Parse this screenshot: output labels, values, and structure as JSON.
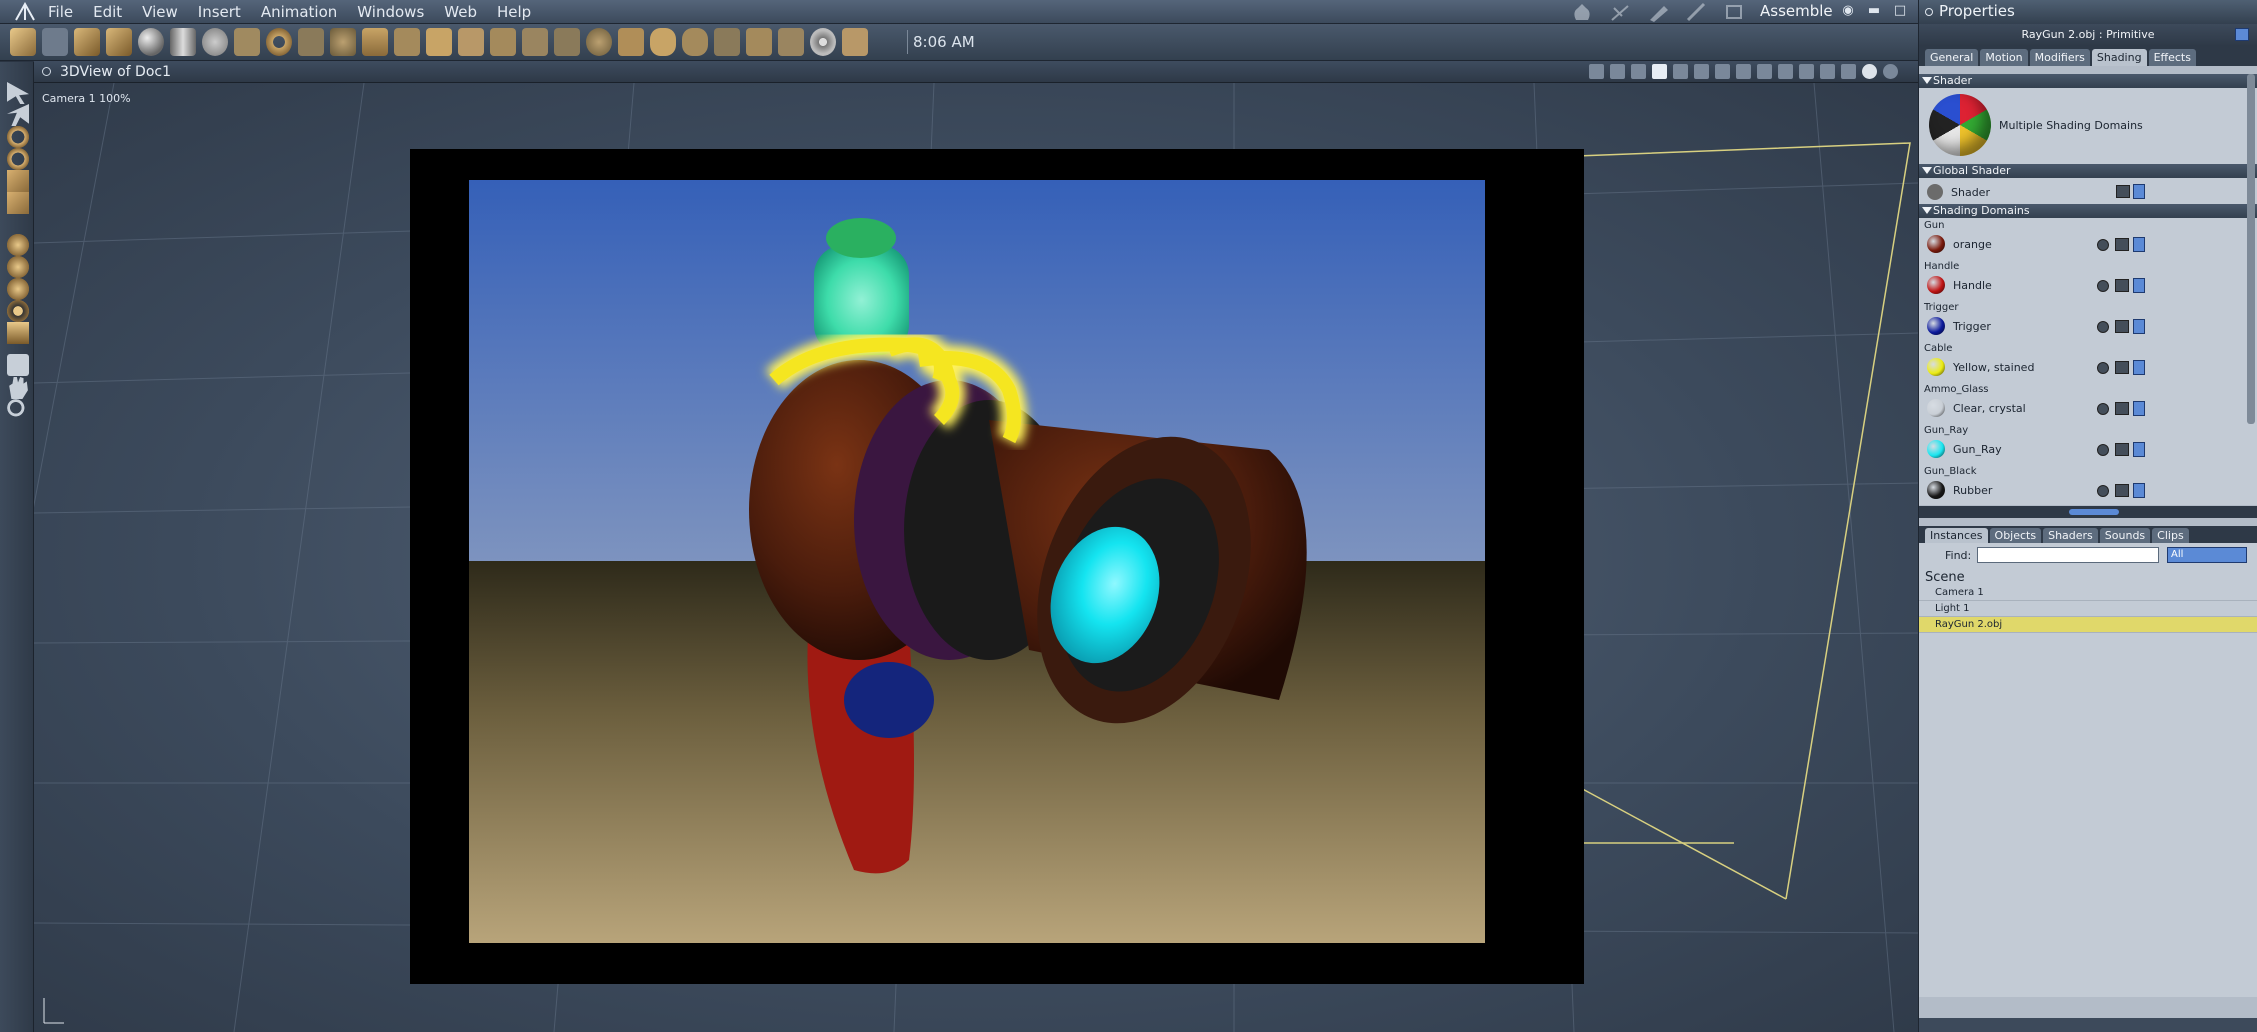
{
  "app": {
    "menu": [
      "File",
      "Edit",
      "View",
      "Insert",
      "Animation",
      "Windows",
      "Web",
      "Help"
    ],
    "room": "Assemble",
    "clock": "8:06 AM"
  },
  "viewport": {
    "title": "3DView of Doc1",
    "camera_label": "Camera 1  100%"
  },
  "properties": {
    "panel_title": "Properties",
    "object_title": "RayGun 2.obj : Primitive",
    "tabs": [
      "General",
      "Motion",
      "Modifiers",
      "Shading",
      "Effects"
    ],
    "active_tab": "Shading",
    "shader_section": "Shader",
    "shader_label": "Multiple Shading Domains",
    "global_section": "Global Shader",
    "global_shader_label": "Shader",
    "domains_section": "Shading Domains",
    "domains": [
      {
        "group": "Gun",
        "name": "orange",
        "color": "#7a1a0c"
      },
      {
        "group": "Handle",
        "name": "Handle",
        "color": "#c01414"
      },
      {
        "group": "Trigger",
        "name": "Trigger",
        "color": "#0c1a9c"
      },
      {
        "group": "Cable",
        "name": "Yellow, stained",
        "color": "#ecec14"
      },
      {
        "group": "Ammo_Glass",
        "name": "Clear, crystal",
        "color": "#c9cfd6"
      },
      {
        "group": "Gun_Ray",
        "name": "Gun_Ray",
        "color": "#1ae6f0"
      },
      {
        "group": "Gun_Black",
        "name": "Rubber",
        "color": "#181818"
      }
    ]
  },
  "browser": {
    "tabs": [
      "Instances",
      "Objects",
      "Shaders",
      "Sounds",
      "Clips"
    ],
    "active_tab": "Instances",
    "find_label": "Find:",
    "find_value": "",
    "filter_value": "All",
    "root": "Scene",
    "items": [
      "Camera 1",
      "Light 1",
      "RayGun 2.obj"
    ],
    "selected_item": "RayGun 2.obj"
  }
}
